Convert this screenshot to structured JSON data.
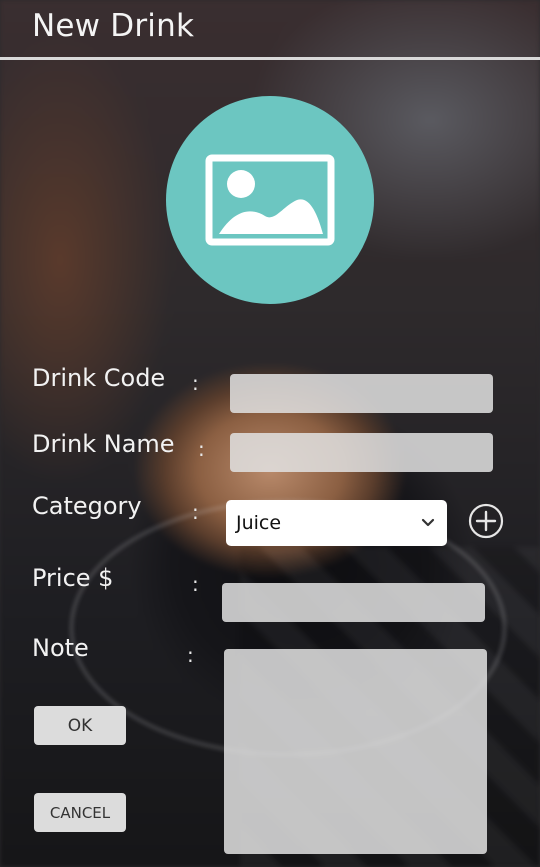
{
  "header": {
    "title": "New Drink"
  },
  "photo": {
    "icon": "image-placeholder-icon",
    "color": "#6cc6c1"
  },
  "form": {
    "drink_code": {
      "label": "Drink Code",
      "separator": ":",
      "value": ""
    },
    "drink_name": {
      "label": "Drink Name",
      "separator": ":",
      "value": ""
    },
    "category": {
      "label": "Category",
      "separator": ":",
      "selected": "Juice",
      "add_icon": "plus-circle-icon",
      "dropdown_icon": "chevron-down-icon"
    },
    "price": {
      "label": "Price $",
      "separator": ":",
      "value": ""
    },
    "note": {
      "label": "Note",
      "separator": ":",
      "value": ""
    }
  },
  "buttons": {
    "ok": "OK",
    "cancel": "CANCEL"
  }
}
